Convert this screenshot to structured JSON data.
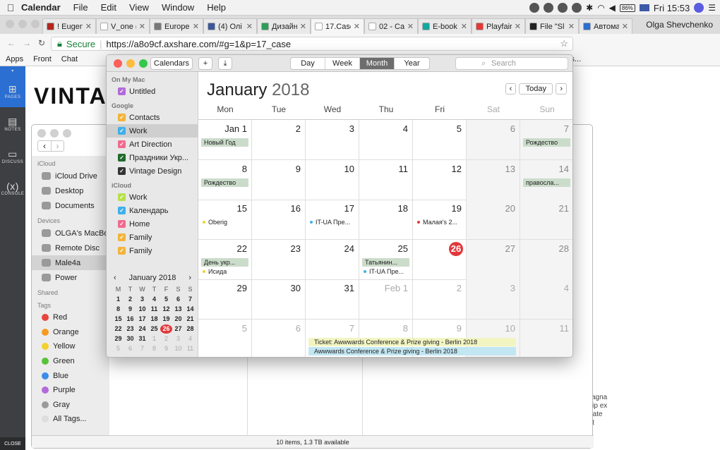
{
  "menubar": {
    "app": "Calendar",
    "items": [
      "File",
      "Edit",
      "View",
      "Window",
      "Help"
    ],
    "clock": "Fri 15:53",
    "battery": "86%"
  },
  "browser": {
    "tabs": [
      {
        "label": "! Eugen",
        "color": "#b3261e"
      },
      {
        "label": "V_one (",
        "color": "#ffffff"
      },
      {
        "label": "Europe",
        "color": "#777777"
      },
      {
        "label": "(4) Олі",
        "color": "#3b5998"
      },
      {
        "label": "Дизайн",
        "color": "#2e9e5b"
      },
      {
        "label": "17.Case",
        "color": "#ffffff"
      },
      {
        "label": "02 - Ca",
        "color": "#ffffff"
      },
      {
        "label": "E-book",
        "color": "#13a89e"
      },
      {
        "label": "Playfair",
        "color": "#e53935"
      },
      {
        "label": "File \"Sl",
        "color": "#222222"
      },
      {
        "label": "Автома",
        "color": "#2a6fd1"
      }
    ],
    "profile": "Olga Shevchenko",
    "secure_label": "Secure",
    "url": "https://a8o9cf.axshare.com/#g=1&p=17_case",
    "bookmarks": [
      "Apps",
      "Front",
      "Chat",
      "/R Uls..."
    ]
  },
  "axure": {
    "sidebar": [
      {
        "label": "PAGES",
        "icon": "pages-icon"
      },
      {
        "label": "NOTES",
        "icon": "notes-icon"
      },
      {
        "label": "DISCUSS",
        "icon": "discuss-icon"
      },
      {
        "label": "CONSOLE",
        "icon": "console-icon"
      }
    ],
    "close_label": "CLOSE",
    "brand": "VINTAG",
    "lorem": [
      "re magna",
      "aliquip ex",
      "ulputate",
      "elenit"
    ]
  },
  "finder": {
    "sections": [
      {
        "title": "iCloud",
        "items": [
          "iCloud Drive",
          "Desktop",
          "Documents"
        ]
      },
      {
        "title": "Devices",
        "items": [
          "OLGA's MacBo",
          "Remote Disc",
          "Male4a",
          "Power"
        ]
      },
      {
        "title": "Shared",
        "items": []
      }
    ],
    "tags_title": "Tags",
    "tags": [
      {
        "label": "Red",
        "color": "#e8453c"
      },
      {
        "label": "Orange",
        "color": "#f59a23"
      },
      {
        "label": "Yellow",
        "color": "#f3d02b"
      },
      {
        "label": "Green",
        "color": "#5ac23a"
      },
      {
        "label": "Blue",
        "color": "#3a8de8"
      },
      {
        "label": "Purple",
        "color": "#b36ad8"
      },
      {
        "label": "Gray",
        "color": "#9a9a9a"
      },
      {
        "label": "All Tags...",
        "color": "#dddddd"
      }
    ],
    "status": "10 items, 1.3 TB available"
  },
  "calendar": {
    "toolbar": {
      "calendars_btn": "Calendars",
      "add_btn": "+",
      "views": [
        "Day",
        "Week",
        "Month",
        "Year"
      ],
      "active_view": "Month",
      "search_placeholder": "Search"
    },
    "sidebar": {
      "groups": [
        {
          "title": "On My Mac",
          "items": [
            {
              "label": "Untitled",
              "color": "#b36ad8",
              "checked": true
            }
          ]
        },
        {
          "title": "Google",
          "items": [
            {
              "label": "Contacts",
              "color": "#f3b43b",
              "checked": true
            },
            {
              "label": "Work",
              "color": "#3fb0e8",
              "checked": true,
              "selected": true
            },
            {
              "label": "Art Direction",
              "color": "#f06a8e",
              "checked": true
            },
            {
              "label": "Праздники Укр...",
              "color": "#1f6b2a",
              "checked": true
            },
            {
              "label": "Vintage Design",
              "color": "#333333",
              "checked": true
            }
          ]
        },
        {
          "title": "iCloud",
          "items": [
            {
              "label": "Work",
              "color": "#b8e04a",
              "checked": true
            },
            {
              "label": "Календарь",
              "color": "#3fb0e8",
              "checked": true
            },
            {
              "label": "Home",
              "color": "#f06a8e",
              "checked": true
            },
            {
              "label": "Family",
              "color": "#f3b43b",
              "checked": true
            },
            {
              "label": "Family",
              "color": "#f3b43b",
              "checked": true
            }
          ]
        }
      ],
      "mini": {
        "title": "January 2018",
        "dow": [
          "M",
          "T",
          "W",
          "T",
          "F",
          "S",
          "S"
        ],
        "weeks": [
          [
            "1",
            "2",
            "3",
            "4",
            "5",
            "6",
            "7"
          ],
          [
            "8",
            "9",
            "10",
            "11",
            "12",
            "13",
            "14"
          ],
          [
            "15",
            "16",
            "17",
            "18",
            "19",
            "20",
            "21"
          ],
          [
            "22",
            "23",
            "24",
            "25",
            "26",
            "27",
            "28"
          ],
          [
            "29",
            "30",
            "31",
            "1",
            "2",
            "3",
            "4"
          ],
          [
            "5",
            "6",
            "7",
            "8",
            "9",
            "10",
            "11"
          ]
        ],
        "today": "26"
      }
    },
    "month": "January",
    "year": "2018",
    "today_btn": "Today",
    "dow": [
      "Mon",
      "Tue",
      "Wed",
      "Thu",
      "Fri",
      "Sat",
      "Sun"
    ],
    "weeks": [
      [
        {
          "d": "Jan 1",
          "ev": [
            {
              "t": "Новый Год",
              "k": "bg"
            }
          ]
        },
        {
          "d": "2"
        },
        {
          "d": "3"
        },
        {
          "d": "4"
        },
        {
          "d": "5"
        },
        {
          "d": "6"
        },
        {
          "d": "7",
          "ev": [
            {
              "t": "Рождество",
              "k": "bg"
            }
          ]
        }
      ],
      [
        {
          "d": "8",
          "ev": [
            {
              "t": "Рождество",
              "k": "bg"
            }
          ]
        },
        {
          "d": "9"
        },
        {
          "d": "10"
        },
        {
          "d": "11"
        },
        {
          "d": "12"
        },
        {
          "d": "13"
        },
        {
          "d": "14",
          "ev": [
            {
              "t": "правосла...",
              "k": "bg"
            }
          ]
        }
      ],
      [
        {
          "d": "15",
          "ev": [
            {
              "t": "Oberig",
              "k": "dot",
              "c": "#f3d02b"
            }
          ]
        },
        {
          "d": "16"
        },
        {
          "d": "17",
          "ev": [
            {
              "t": "IT-UA Пре...",
              "k": "dot",
              "c": "#3fb0e8"
            }
          ]
        },
        {
          "d": "18"
        },
        {
          "d": "19",
          "ev": [
            {
              "t": "Малая's 2...",
              "k": "dot",
              "c": "#e2383c"
            }
          ]
        },
        {
          "d": "20"
        },
        {
          "d": "21"
        }
      ],
      [
        {
          "d": "22",
          "ev": [
            {
              "t": "День укр...",
              "k": "bg"
            },
            {
              "t": "Исида",
              "k": "dot",
              "c": "#f3d02b"
            }
          ]
        },
        {
          "d": "23"
        },
        {
          "d": "24"
        },
        {
          "d": "25",
          "ev": [
            {
              "t": "Татьянин...",
              "k": "bg"
            },
            {
              "t": "IT-UA Пре...",
              "k": "dot",
              "c": "#3fb0e8"
            }
          ]
        },
        {
          "d": "26",
          "today": true
        },
        {
          "d": "27"
        },
        {
          "d": "28"
        }
      ],
      [
        {
          "d": "29"
        },
        {
          "d": "30"
        },
        {
          "d": "31"
        },
        {
          "d": "Feb 1",
          "other": true
        },
        {
          "d": "2",
          "other": true
        },
        {
          "d": "3",
          "other": true
        },
        {
          "d": "4",
          "other": true
        }
      ],
      [
        {
          "d": "5",
          "other": true
        },
        {
          "d": "6",
          "other": true
        },
        {
          "d": "7",
          "other": true
        },
        {
          "d": "8",
          "other": true
        },
        {
          "d": "9",
          "other": true
        },
        {
          "d": "10",
          "other": true
        },
        {
          "d": "11",
          "other": true
        }
      ]
    ],
    "spanning_events": [
      {
        "t": "Ticket: Awwwards Conference & Prize giving - Berlin 2018",
        "color": "#f2f5c2"
      },
      {
        "t": "Awwwards Conference & Prize giving - Berlin 2018",
        "color": "#c2e6f2"
      }
    ]
  }
}
